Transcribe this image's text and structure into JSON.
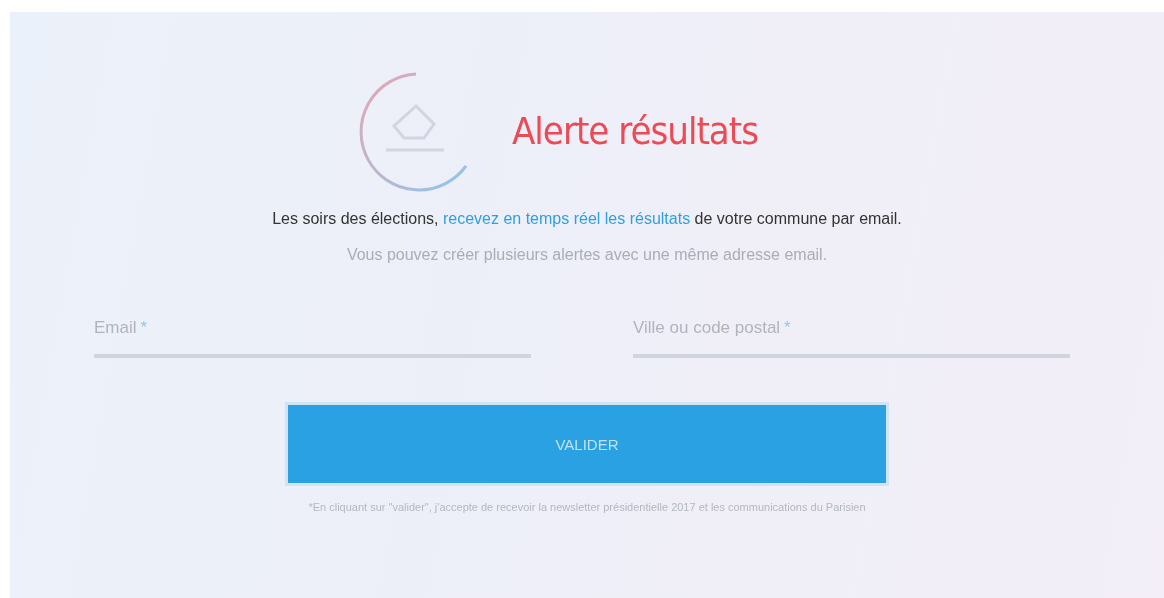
{
  "title": "Alerte résultats",
  "intro": {
    "before": "Les soirs des élections, ",
    "link": "recevez en temps réel les résultats",
    "after": " de votre commune par email."
  },
  "note": "Vous pouvez créer plusieurs alertes avec une même adresse email.",
  "fields": [
    {
      "placeholder": "Email",
      "required_mark": "*"
    },
    {
      "placeholder": "Ville ou code postal",
      "required_mark": "*"
    }
  ],
  "submit": "VALIDER",
  "disclaimer": "*En cliquant sur \"valider\", j'accepte de recevoir la newsletter présidentielle 2017 et les communications du Parisien"
}
